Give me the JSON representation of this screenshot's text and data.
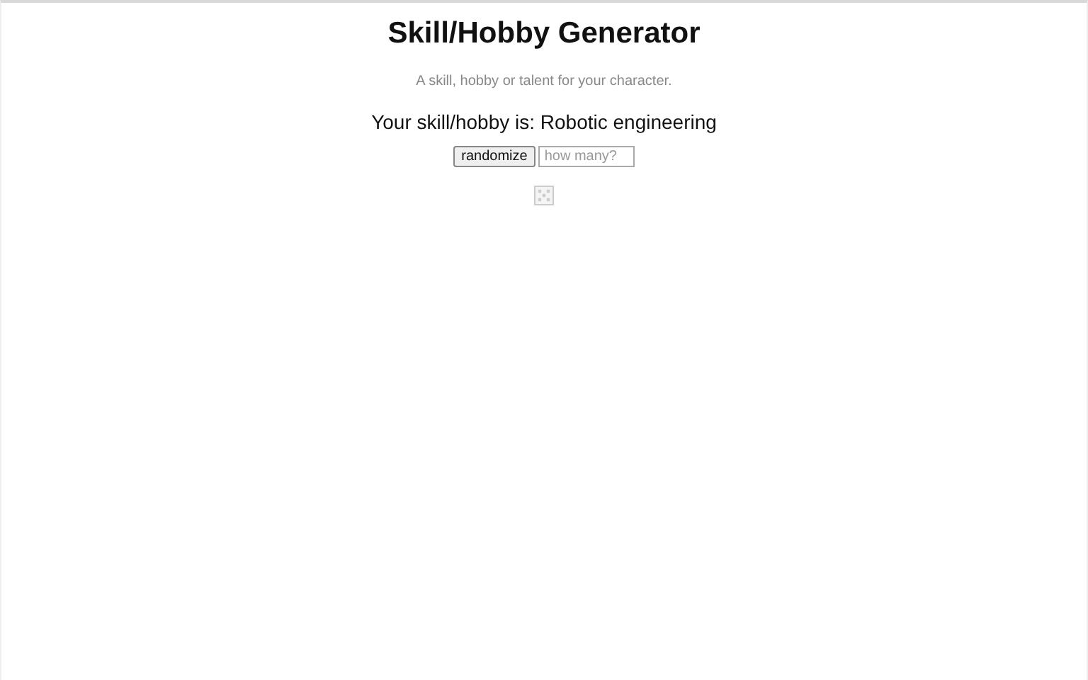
{
  "title": "Skill/Hobby Generator",
  "subtitle": "A skill, hobby or talent for your character.",
  "result": "Your skill/hobby is: Robotic engineering",
  "randomize_button": "randomize",
  "count_field": {
    "placeholder": "how many?"
  }
}
